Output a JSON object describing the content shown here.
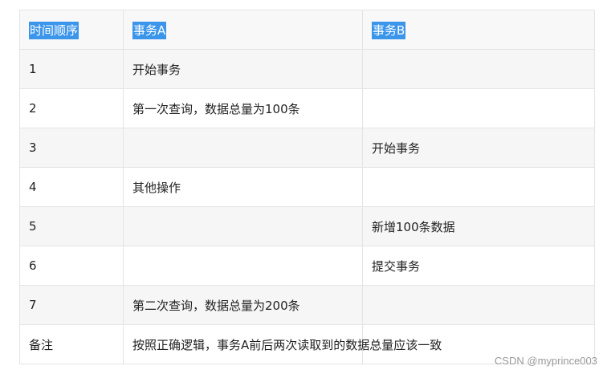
{
  "table": {
    "headers": [
      "时间顺序",
      "事务A",
      "事务B"
    ],
    "rows": [
      [
        "1",
        "开始事务",
        ""
      ],
      [
        "2",
        "第一次查询，数据总量为100条",
        ""
      ],
      [
        "3",
        "",
        "开始事务"
      ],
      [
        "4",
        "其他操作",
        ""
      ],
      [
        "5",
        "",
        "新增100条数据"
      ],
      [
        "6",
        "",
        "提交事务"
      ],
      [
        "7",
        "第二次查询，数据总量为200条",
        ""
      ],
      [
        "备注",
        "按照正确逻辑，事务A前后两次读取到的数据总量应该一致",
        ""
      ]
    ]
  },
  "watermark": "CSDN @myprince003",
  "colors": {
    "header_highlight": "#3b95ea",
    "header_text": "#ffffff",
    "row_odd_bg": "#f6f6f6",
    "row_even_bg": "#ffffff",
    "border": "#e4e4e4"
  }
}
